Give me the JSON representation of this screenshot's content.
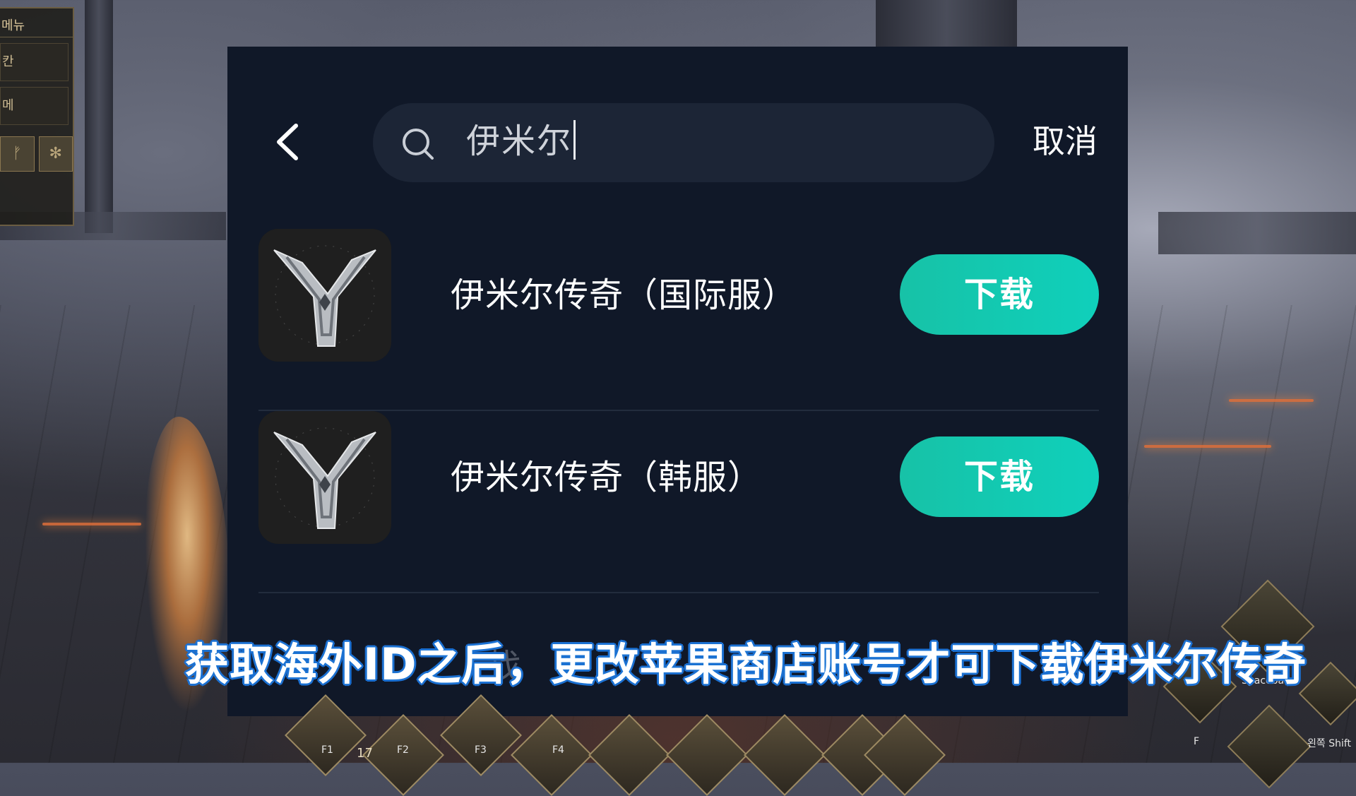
{
  "game_menu": {
    "title": "메뉴",
    "rows": [
      "칸",
      "메"
    ],
    "slots": [
      "ᚠ",
      "✻"
    ]
  },
  "search": {
    "query": "伊米尔",
    "cancel_label": "取消"
  },
  "results": [
    {
      "name": "伊米尔传奇（国际服）",
      "button": "下载"
    },
    {
      "name": "伊米尔传奇（韩服）",
      "button": "下载"
    }
  ],
  "ghost_text": "找",
  "subtitle": "获取海外ID之后，更改苹果商店账号才可下载伊米尔传奇",
  "hud": {
    "level": "17",
    "keys": [
      "F1",
      "F2",
      "F3",
      "F4",
      "F",
      "Spacebar",
      "왼쪽 Shift"
    ]
  },
  "colors": {
    "panel_bg": "#101828",
    "search_bg": "#1c2536",
    "download_button": "#17c2a7",
    "subtitle_outline": "#1d6fd1"
  }
}
